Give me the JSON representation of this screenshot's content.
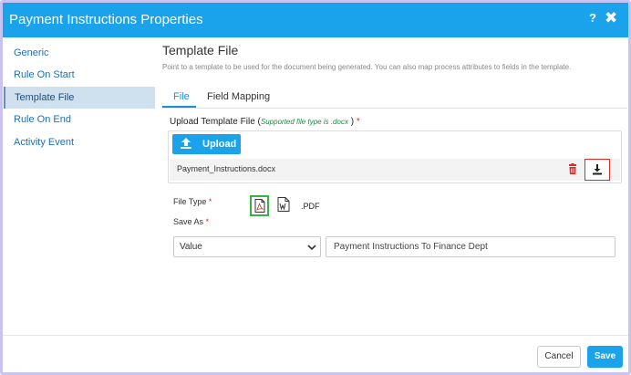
{
  "dialog": {
    "title": "Payment Instructions Properties",
    "help_label": "?",
    "close_label": "✖"
  },
  "sidebar": {
    "items": [
      {
        "label": "Generic"
      },
      {
        "label": "Rule On Start"
      },
      {
        "label": "Template File",
        "active": true
      },
      {
        "label": "Rule On End"
      },
      {
        "label": "Activity Event"
      }
    ]
  },
  "main": {
    "title": "Template File",
    "description": "Point to a template to be used for the document being generated. You can also map process attributes to fields in the template.",
    "tabs": [
      {
        "label": "File",
        "active": true
      },
      {
        "label": "Field Mapping"
      }
    ],
    "upload": {
      "label": "Upload Template File",
      "open_paren": "(",
      "hint": "Supported file type is .docx",
      "close_paren": ")",
      "required_mark": "*",
      "button_label": "Upload",
      "file_name": "Payment_Instructions.docx"
    },
    "file_type": {
      "label": "File Type",
      "required_mark": "*",
      "selected_text": ".PDF"
    },
    "save_as": {
      "label": "Save As",
      "required_mark": "*",
      "select_value": "Value",
      "input_value": "Payment Instructions To Finance Dept"
    }
  },
  "footer": {
    "cancel_label": "Cancel",
    "save_label": "Save"
  },
  "colors": {
    "accent": "#1aa3ea",
    "required": "#e0262b",
    "hint_green": "#1d8a4a",
    "selected_border": "#3cb043",
    "highlight_red": "#e02a2a"
  },
  "icons": [
    "help-icon",
    "close-icon",
    "upload-icon",
    "trash-icon",
    "download-icon",
    "pdf-icon",
    "word-icon",
    "chevron-down-icon"
  ]
}
